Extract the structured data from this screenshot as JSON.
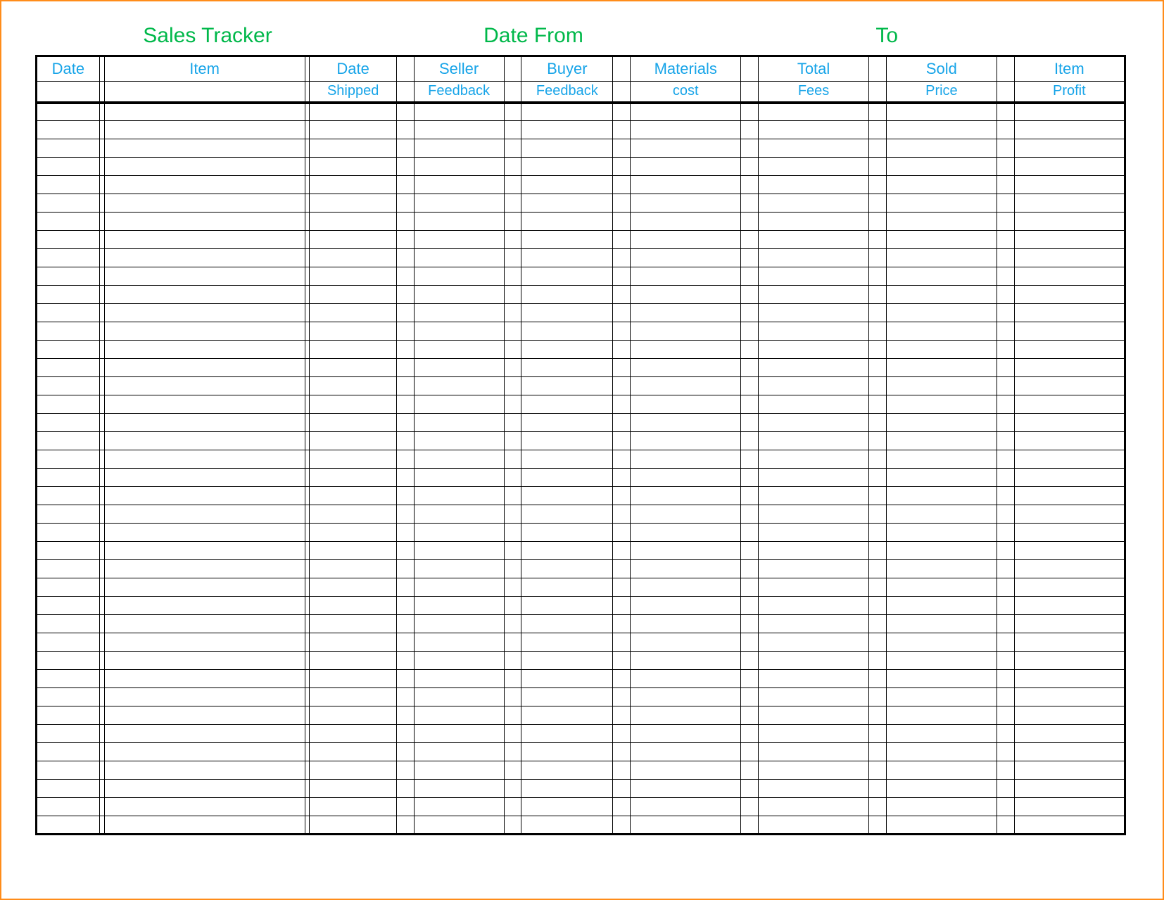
{
  "header": {
    "title": "Sales Tracker",
    "date_from_label": "Date From",
    "to_label": "To"
  },
  "columns": {
    "row1": {
      "date": "Date",
      "item": "Item",
      "date2": "Date",
      "seller": "Seller",
      "buyer": "Buyer",
      "materials": "Materials",
      "total": "Total",
      "sold": "Sold",
      "item2": "Item"
    },
    "row2": {
      "date": "",
      "item": "",
      "date2": "Shipped",
      "seller": "Feedback",
      "buyer": "Feedback",
      "materials": "cost",
      "total": "Fees",
      "sold": "Price",
      "item2": "Profit"
    }
  },
  "body_row_count": 40
}
